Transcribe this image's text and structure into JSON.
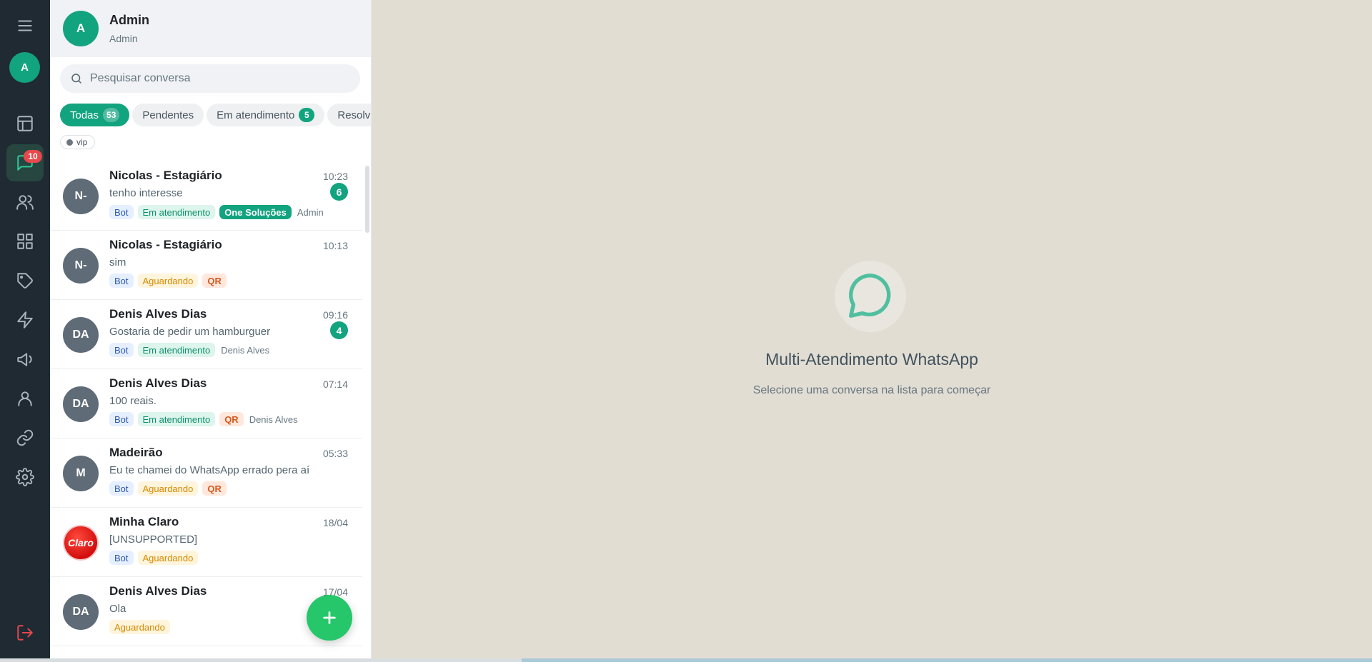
{
  "rail": {
    "avatar_initial": "A",
    "chat_badge": "10",
    "items": [
      {
        "name": "menu-icon"
      },
      {
        "name": "dashboard-icon"
      },
      {
        "name": "chat-icon"
      },
      {
        "name": "contacts-icon"
      },
      {
        "name": "apps-icon"
      },
      {
        "name": "tag-icon"
      },
      {
        "name": "lightning-icon"
      },
      {
        "name": "megaphone-icon"
      },
      {
        "name": "user-icon"
      },
      {
        "name": "link-icon"
      },
      {
        "name": "gear-icon"
      },
      {
        "name": "logout-icon"
      }
    ]
  },
  "header": {
    "avatar_initial": "A",
    "name": "Admin",
    "role": "Admin"
  },
  "search": {
    "placeholder": "Pesquisar conversa"
  },
  "filters": [
    {
      "label": "Todas",
      "count": "53",
      "active": true
    },
    {
      "label": "Pendentes",
      "count": null,
      "active": false
    },
    {
      "label": "Em atendimento",
      "count": "5",
      "active": false
    },
    {
      "label": "Resolvi",
      "count": null,
      "active": false
    }
  ],
  "tag_filter": {
    "label": "vip"
  },
  "conversations": [
    {
      "initials": "N-",
      "name": "Nicolas - Estagiário",
      "time": "10:23",
      "preview": "tenho interesse",
      "unread": "6",
      "tags": [
        {
          "text": "Bot",
          "kind": "bot"
        },
        {
          "text": "Em atendimento",
          "kind": "atend"
        },
        {
          "text": "One Soluções",
          "kind": "company"
        },
        {
          "text": "Admin",
          "kind": "agent"
        }
      ]
    },
    {
      "initials": "N-",
      "name": "Nicolas - Estagiário",
      "time": "10:13",
      "preview": "sim",
      "unread": null,
      "tags": [
        {
          "text": "Bot",
          "kind": "bot"
        },
        {
          "text": "Aguardando",
          "kind": "aguard"
        },
        {
          "text": "QR",
          "kind": "qr"
        }
      ]
    },
    {
      "initials": "DA",
      "name": "Denis Alves Dias",
      "time": "09:16",
      "preview": "Gostaria de pedir um hamburguer",
      "unread": "4",
      "tags": [
        {
          "text": "Bot",
          "kind": "bot"
        },
        {
          "text": "Em atendimento",
          "kind": "atend"
        },
        {
          "text": "Denis Alves",
          "kind": "agent"
        }
      ]
    },
    {
      "initials": "DA",
      "name": "Denis Alves Dias",
      "time": "07:14",
      "preview": "100 reais.",
      "unread": null,
      "tags": [
        {
          "text": "Bot",
          "kind": "bot"
        },
        {
          "text": "Em atendimento",
          "kind": "atend"
        },
        {
          "text": "QR",
          "kind": "qr"
        },
        {
          "text": "Denis Alves",
          "kind": "agent"
        }
      ]
    },
    {
      "initials": "M",
      "name": "Madeirão",
      "time": "05:33",
      "preview": "Eu te chamei do WhatsApp errado pera aí",
      "unread": null,
      "tags": [
        {
          "text": "Bot",
          "kind": "bot"
        },
        {
          "text": "Aguardando",
          "kind": "aguard"
        },
        {
          "text": "QR",
          "kind": "qr"
        }
      ]
    },
    {
      "initials": "Claro",
      "name": "Minha Claro",
      "time": "18/04",
      "preview": "[UNSUPPORTED]",
      "unread": null,
      "avatar_style": "claro",
      "tags": [
        {
          "text": "Bot",
          "kind": "bot"
        },
        {
          "text": "Aguardando",
          "kind": "aguard"
        }
      ]
    },
    {
      "initials": "DA",
      "name": "Denis Alves Dias",
      "time": "17/04",
      "preview": "Ola",
      "unread": null,
      "tags": [
        {
          "text": "Aguardando",
          "kind": "aguard"
        }
      ]
    }
  ],
  "empty_state": {
    "title": "Multi-Atendimento WhatsApp",
    "subtitle": "Selecione uma conversa na lista para começar"
  },
  "colors": {
    "accent": "#12a37f",
    "rail_bg": "#1f2a33",
    "badge": "#e5484d",
    "fab": "#25c76a"
  }
}
